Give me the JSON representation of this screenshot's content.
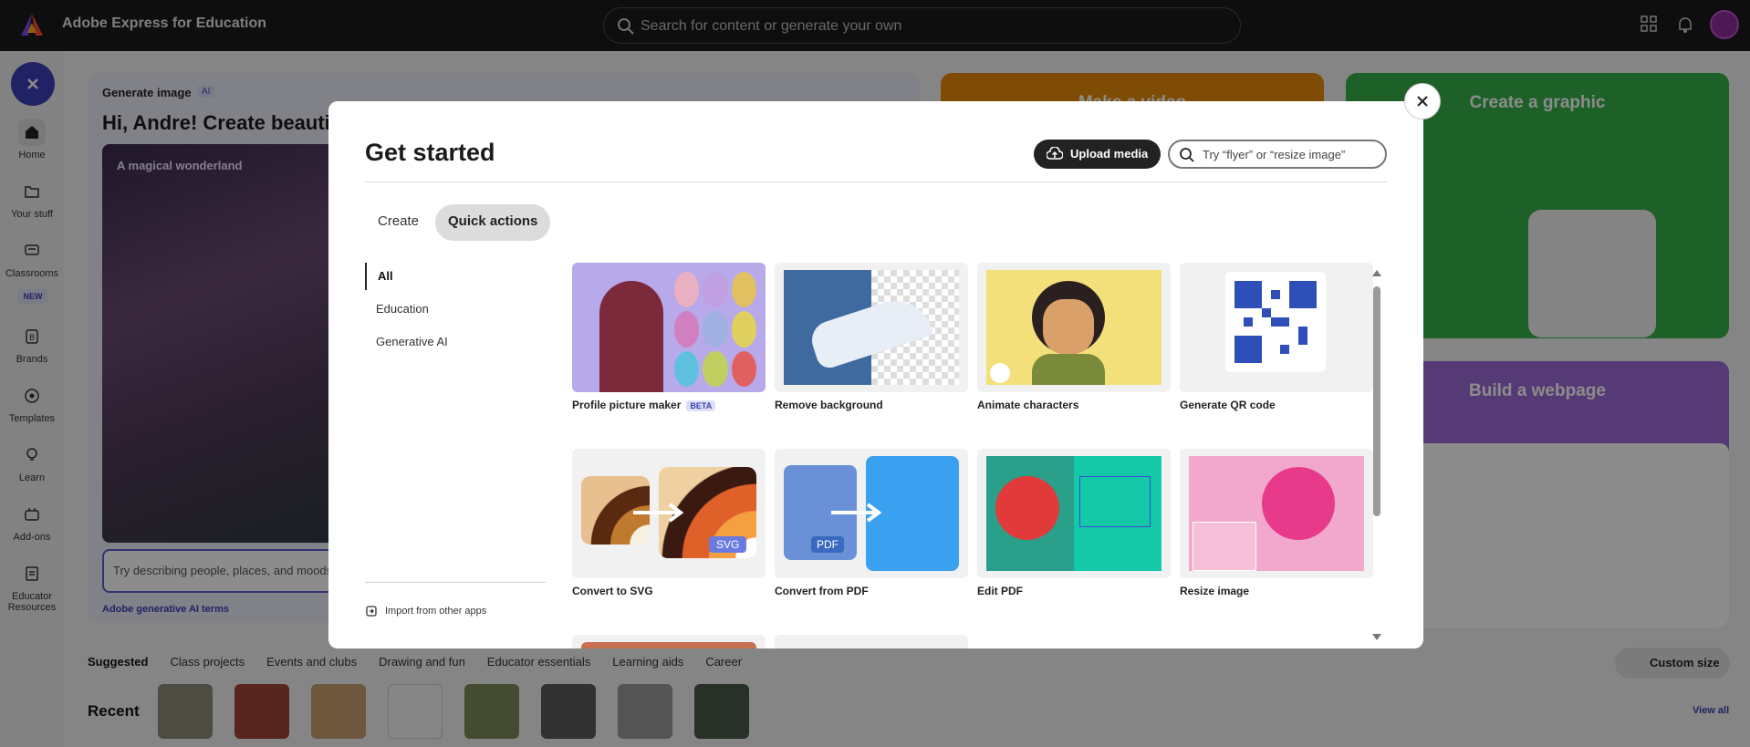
{
  "app": {
    "title": "Adobe Express for Education",
    "search_placeholder": "Search for content or generate your own"
  },
  "rail": {
    "items": [
      {
        "label": "Home"
      },
      {
        "label": "Your stuff"
      },
      {
        "label": "Classrooms"
      },
      {
        "label": "Brands"
      },
      {
        "label": "Templates"
      },
      {
        "label": "Learn"
      },
      {
        "label": "Add-ons"
      },
      {
        "label": "Educator Resources"
      }
    ],
    "new_badge": "NEW"
  },
  "background": {
    "gen_label": "Generate image",
    "ai_tag": "AI",
    "gen_heading": "Hi, Andre! Create beautifu",
    "gen_image_caption": "A magical wonderland",
    "gen_input_placeholder": "Try describing people, places, and moods",
    "gen_terms": "Adobe generative AI terms",
    "video_title": "Make a video",
    "graphic_title": "Create a graphic",
    "web_title": "Build a webpage",
    "tabs": [
      "Suggested",
      "Class projects",
      "Events and clubs",
      "Drawing and fun",
      "Educator essentials",
      "Learning aids",
      "Career"
    ],
    "custom_size": "Custom size",
    "recent_label": "Recent",
    "view_all": "View all"
  },
  "modal": {
    "title": "Get started",
    "upload_label": "Upload media",
    "search_placeholder": "Try “flyer” or “resize image”",
    "tabs": [
      "Create",
      "Quick actions"
    ],
    "categories": [
      "All",
      "Education",
      "Generative AI"
    ],
    "import_label": "Import from other apps",
    "tiles": [
      {
        "label": "Profile picture maker",
        "badge": "BETA"
      },
      {
        "label": "Remove background"
      },
      {
        "label": "Animate characters"
      },
      {
        "label": "Generate QR code"
      },
      {
        "label": "Convert to SVG",
        "badge": "SVG"
      },
      {
        "label": "Convert from PDF",
        "badge": "PDF"
      },
      {
        "label": "Edit PDF"
      },
      {
        "label": "Resize image"
      }
    ]
  }
}
